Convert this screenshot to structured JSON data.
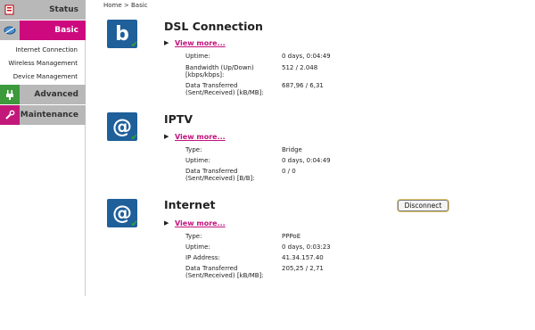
{
  "sidebar": {
    "status_label": "Status",
    "basic_label": "Basic",
    "basic_items": [
      "Internet Connection",
      "Wireless Management",
      "Device Management"
    ],
    "advanced_label": "Advanced",
    "maintenance_label": "Maintenance"
  },
  "breadcrumb": "Home > Basic",
  "dsl": {
    "icon_letter": "b",
    "title": "DSL Connection",
    "view_more": "View more...",
    "rows": [
      {
        "label": "Uptime:",
        "value": "0 days, 0:04:49"
      },
      {
        "label": "Bandwidth (Up/Down) [kbps/kbps]:",
        "value": "512 / 2.048"
      },
      {
        "label": "Data Transferred (Sent/Received) [kB/MB]:",
        "value": "687,96 / 6,31"
      }
    ]
  },
  "iptv": {
    "icon_letter": "@",
    "title": "IPTV",
    "view_more": "View more...",
    "rows": [
      {
        "label": "Type:",
        "value": "Bridge"
      },
      {
        "label": "Uptime:",
        "value": "0 days, 0:04:49"
      },
      {
        "label": "Data Transferred (Sent/Received) [B/B]:",
        "value": "0 / 0"
      }
    ]
  },
  "internet": {
    "icon_letter": "@",
    "title": "Internet",
    "view_more": "View more...",
    "disconnect_label": "Disconnect",
    "rows": [
      {
        "label": "Type:",
        "value": "PPPoE"
      },
      {
        "label": "Uptime:",
        "value": "0 days, 0:03:23"
      },
      {
        "label": "IP Address:",
        "value": "41.34.157.40"
      },
      {
        "label": "Data Transferred (Sent/Received) [kB/MB]:",
        "value": "205,25 / 2,71"
      }
    ]
  },
  "colors": {
    "accent": "#cc0a7e",
    "menu_grey": "#b8b8b8",
    "icon_blue": "#1f5f9a"
  },
  "icons": {
    "status": "router-icon",
    "basic": "network-icon",
    "advanced": "plug-icon",
    "maintenance": "wrench-icon"
  }
}
